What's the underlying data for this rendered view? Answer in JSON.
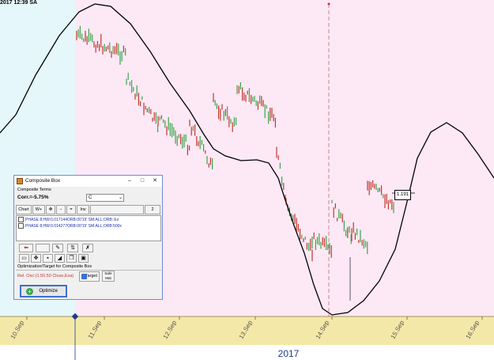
{
  "header": {
    "timestamp": "2017 12:39 SA"
  },
  "chart": {
    "year_label": "2017",
    "date_labels": [
      "10.Sep",
      "11.Sep",
      "12.Sep",
      "13.Sep",
      "14.Sep",
      "15.Sep",
      "16.Sep"
    ],
    "price_marker": "1.191",
    "colors": {
      "highlight_region": "#fde8f6",
      "cyan_region": "#e6f7fb",
      "axis_band": "#f4e8a8",
      "up_bar": "#3aa64a",
      "down_bar": "#c0392b",
      "curve": "#000000"
    }
  },
  "composite_box": {
    "title": "Composite Box",
    "composite_terms_label": "Composite Terms",
    "corr_label": "Corr.=-5.75%",
    "combo_value": "C",
    "toolbar": [
      "Chart",
      "W+",
      "Inv",
      "2"
    ],
    "items": [
      "PHASE 8;HW:0.017144ORB:00'19' SM:ALL;ORB::Ex",
      "PHASE 8;HW:0.014277ORB:00'15' SM:ALL;ORB:500x"
    ],
    "opt_target_label": "Optimization/Target for Composite Box",
    "target_text": "Rel. Osc:(1.50.50 Close,Exa)",
    "target_button": "Target",
    "safe_button": "Safe Mat",
    "optimize_button": "Optimize"
  }
}
